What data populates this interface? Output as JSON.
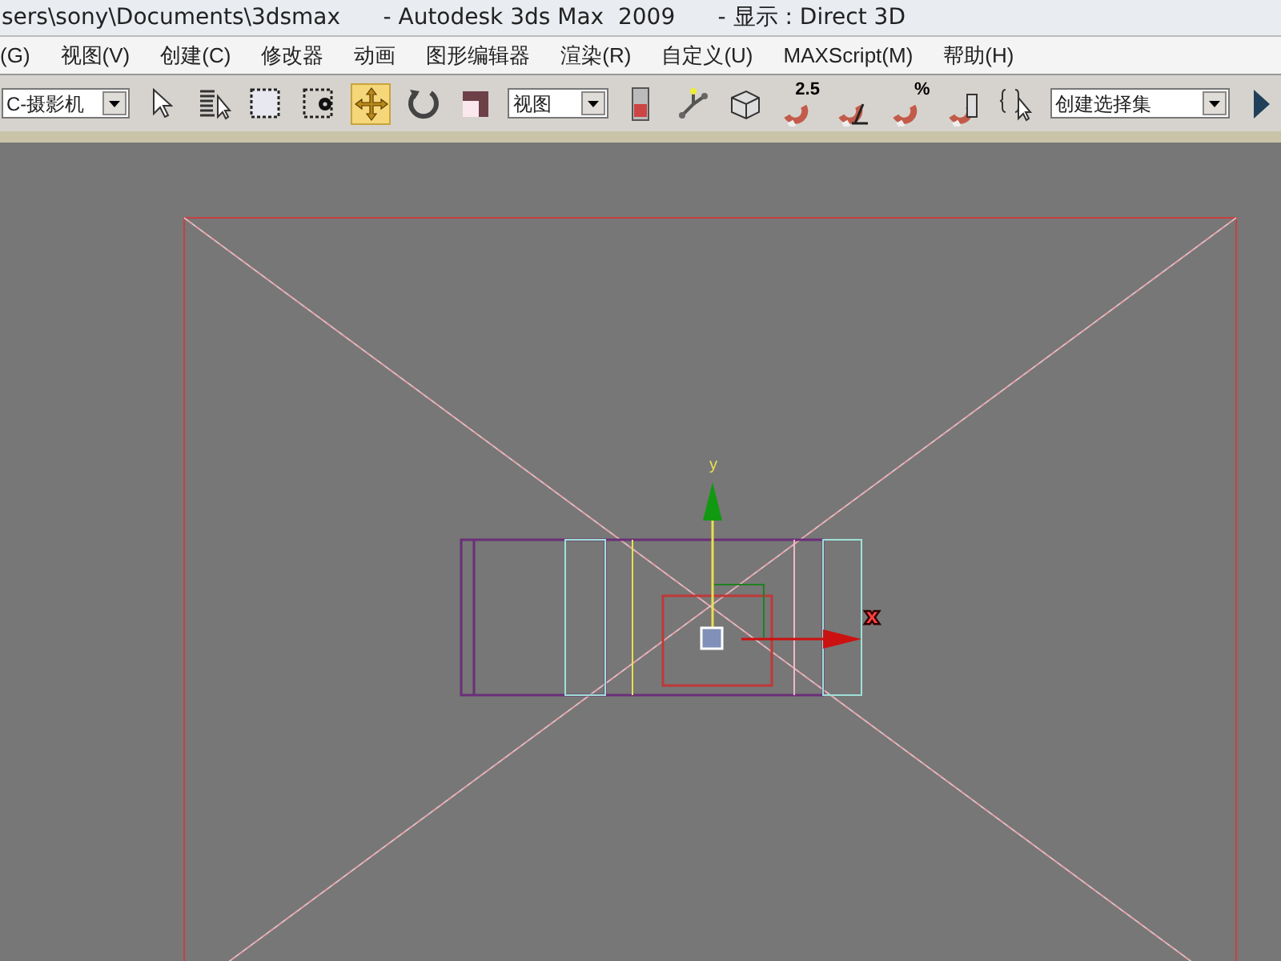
{
  "window": {
    "title": "sers\\sony\\Documents\\3dsmax      - Autodesk 3ds Max  2009      - 显示 : Direct 3D"
  },
  "menu": {
    "items": [
      "(G)",
      "视图(V)",
      "创建(C)",
      "修改器",
      "动画",
      "图形编辑器",
      "渲染(R)",
      "自定义(U)",
      "MAXScript(M)",
      "帮助(H)"
    ]
  },
  "toolbar": {
    "camera_dropdown": "C-摄影机",
    "view_dropdown": "视图",
    "selection_set_dropdown": "创建选择集",
    "tools": [
      {
        "kind": "select",
        "selected": false
      },
      {
        "kind": "select-by-name",
        "selected": false
      },
      {
        "kind": "region",
        "selected": false
      },
      {
        "kind": "window",
        "selected": false
      },
      {
        "kind": "move",
        "selected": true
      },
      {
        "kind": "rotate",
        "selected": false
      },
      {
        "kind": "scale",
        "selected": false
      }
    ],
    "snap_label": "2.5",
    "percent_label": "%"
  },
  "viewport": {
    "axis_y_label": "y",
    "axis_x_label": "x"
  }
}
